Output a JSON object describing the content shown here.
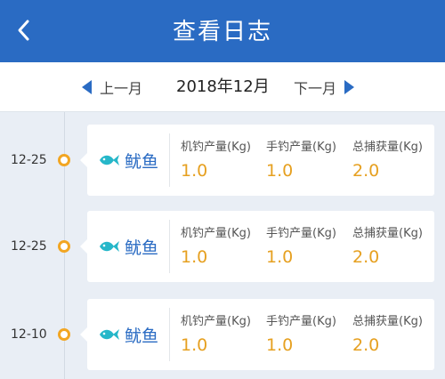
{
  "header": {
    "title": "查看日志",
    "back_icon": "chevron-left-icon"
  },
  "month_nav": {
    "prev_label": "上一月",
    "current": "2018年12月",
    "next_label": "下一月",
    "arrow_color": "#2a6bc3"
  },
  "entries": [
    {
      "date": "12-25",
      "species": "鱿鱼",
      "metrics": [
        {
          "label": "机钓产量(Kg)",
          "value": "1.0"
        },
        {
          "label": "手钓产量(Kg)",
          "value": "1.0"
        },
        {
          "label": "总捕获量(Kg)",
          "value": "2.0"
        }
      ]
    },
    {
      "date": "12-25",
      "species": "鱿鱼",
      "metrics": [
        {
          "label": "机钓产量(Kg)",
          "value": "1.0"
        },
        {
          "label": "手钓产量(Kg)",
          "value": "1.0"
        },
        {
          "label": "总捕获量(Kg)",
          "value": "2.0"
        }
      ]
    },
    {
      "date": "12-10",
      "species": "鱿鱼",
      "metrics": [
        {
          "label": "机钓产量(Kg)",
          "value": "1.0"
        },
        {
          "label": "手钓产量(Kg)",
          "value": "1.0"
        },
        {
          "label": "总捕获量(Kg)",
          "value": "2.0"
        }
      ]
    }
  ],
  "colors": {
    "header_bg": "#2a6bc3",
    "value_color": "#e6a020",
    "dot_color": "#f2a623",
    "fish_icon_color": "#26b7c9"
  }
}
